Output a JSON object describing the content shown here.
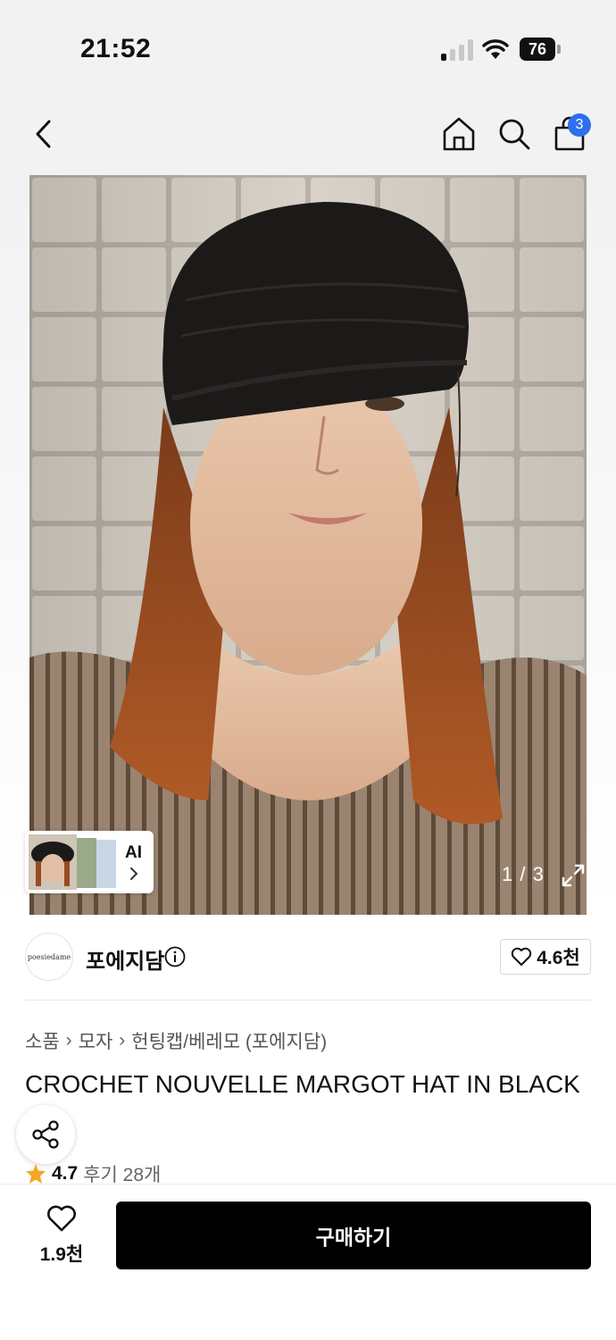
{
  "status_bar": {
    "time": "21:52",
    "battery": "76",
    "icons": [
      "cellular-signal-icon",
      "wifi-icon",
      "battery-icon"
    ]
  },
  "nav": {
    "icons": [
      "back-chevron-icon",
      "home-icon",
      "search-icon",
      "shopping-bag-icon"
    ],
    "cart_count": "3",
    "accent_color": "#2f6fed"
  },
  "gallery": {
    "page_indicator": "1 / 3",
    "ai_chip_label": "AI",
    "icons": [
      "expand-icon",
      "chevron-right-icon"
    ]
  },
  "brand": {
    "logo_text": "poesiedame",
    "name": "포에지담",
    "like_count": "4.6천",
    "icons": [
      "info-icon",
      "heart-outline-icon"
    ]
  },
  "breadcrumb": [
    "소품",
    "모자",
    "헌팅캡/베레모 (포에지담)"
  ],
  "product": {
    "title": "CROCHET NOUVELLE MARGOT HAT IN BLACK",
    "rating": "4.7",
    "review_text": "후기 28개",
    "star_color": "#f5a623"
  },
  "bottom_bar": {
    "wishlist_count": "1.9천",
    "buy_label": "구매하기",
    "icons": [
      "share-icon",
      "heart-outline-icon"
    ]
  }
}
